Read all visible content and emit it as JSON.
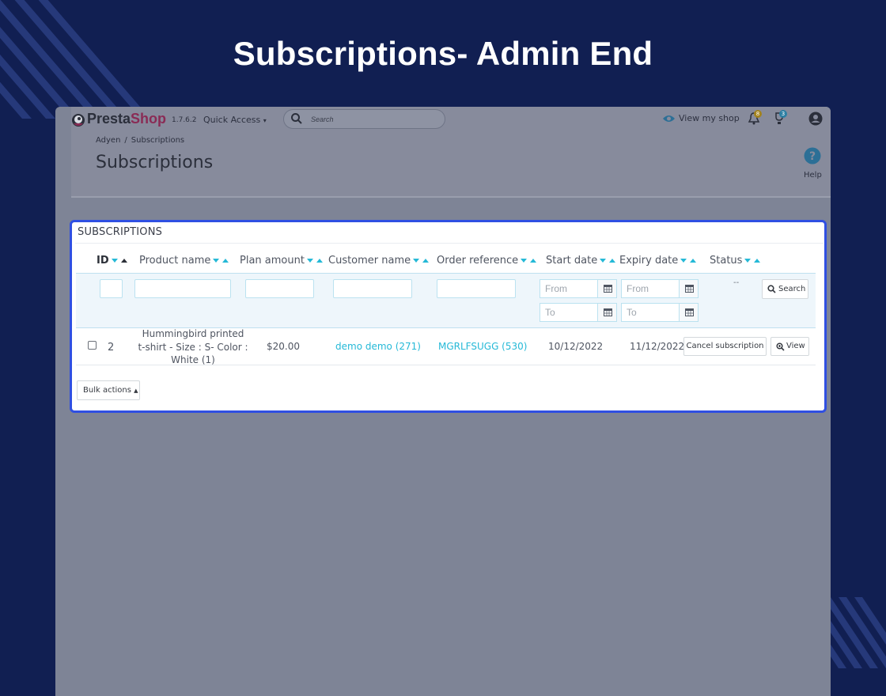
{
  "hero": {
    "title": "Subscriptions- Admin End"
  },
  "topbar": {
    "logo_part1": "Presta",
    "logo_part2": "Shop",
    "version": "1.7.6.2",
    "quick_access": "Quick Access",
    "search_placeholder": "Search",
    "view_my_shop": "View my shop",
    "notifications_badge": "8",
    "orders_badge": "3"
  },
  "breadcrumb": {
    "parent": "Adyen",
    "separator": "/",
    "current": "Subscriptions"
  },
  "page": {
    "title": "Subscriptions",
    "help": "Help"
  },
  "panel": {
    "heading": "SUBSCRIPTIONS",
    "columns": {
      "id": "ID",
      "product_name": "Product name",
      "plan_amount": "Plan amount",
      "customer_name": "Customer name",
      "order_reference": "Order reference",
      "start_date": "Start date",
      "expiry_date": "Expiry date",
      "status": "Status"
    },
    "filters": {
      "from_placeholder": "From",
      "to_placeholder": "To",
      "status_dash": "--",
      "search_label": "Search"
    },
    "rows": [
      {
        "id": "2",
        "product_name": "Hummingbird printed t-shirt - Size : S- Color : White (1)",
        "plan_amount": "$20.00",
        "customer_name": "demo demo (271)",
        "order_reference": "MGRLFSUGG (530)",
        "start_date": "10/12/2022",
        "expiry_date": "11/12/2022",
        "cancel_label": "Cancel subscription",
        "view_label": "View"
      }
    ],
    "bulk_actions": "Bulk actions"
  },
  "colors": {
    "background": "#111f52",
    "panel_border": "#2f4fe2",
    "link": "#25b9d7",
    "logo_accent": "#8a2b55"
  }
}
